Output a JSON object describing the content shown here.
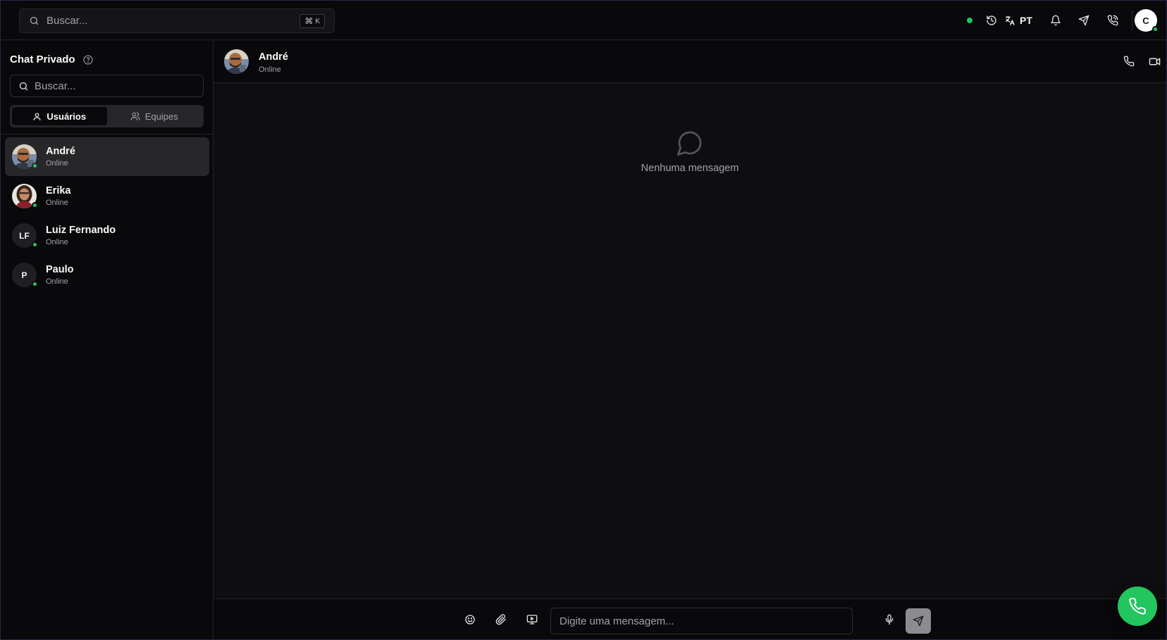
{
  "topbar": {
    "search_placeholder": "Buscar...",
    "shortcut_symbol": "⌘",
    "shortcut_key": "K",
    "language": "PT",
    "user_initial": "C",
    "status_color": "#22c55e"
  },
  "sidebar": {
    "title": "Chat Privado",
    "search_placeholder": "Buscar...",
    "tabs": [
      {
        "label": "Usuários",
        "active": true
      },
      {
        "label": "Equipes",
        "active": false
      }
    ],
    "contacts": [
      {
        "name": "André",
        "status": "Online",
        "initials": "",
        "selected": true
      },
      {
        "name": "Erika",
        "status": "Online",
        "initials": "",
        "selected": false
      },
      {
        "name": "Luiz Fernando",
        "status": "Online",
        "initials": "LF",
        "selected": false
      },
      {
        "name": "Paulo",
        "status": "Online",
        "initials": "P",
        "selected": false
      }
    ]
  },
  "chat": {
    "name": "André",
    "status": "Online",
    "empty_text": "Nenhuma mensagem",
    "input_placeholder": "Digite uma mensagem..."
  },
  "colors": {
    "accent_green": "#22c55e",
    "background": "#0e0e10",
    "panel": "#09090b"
  }
}
